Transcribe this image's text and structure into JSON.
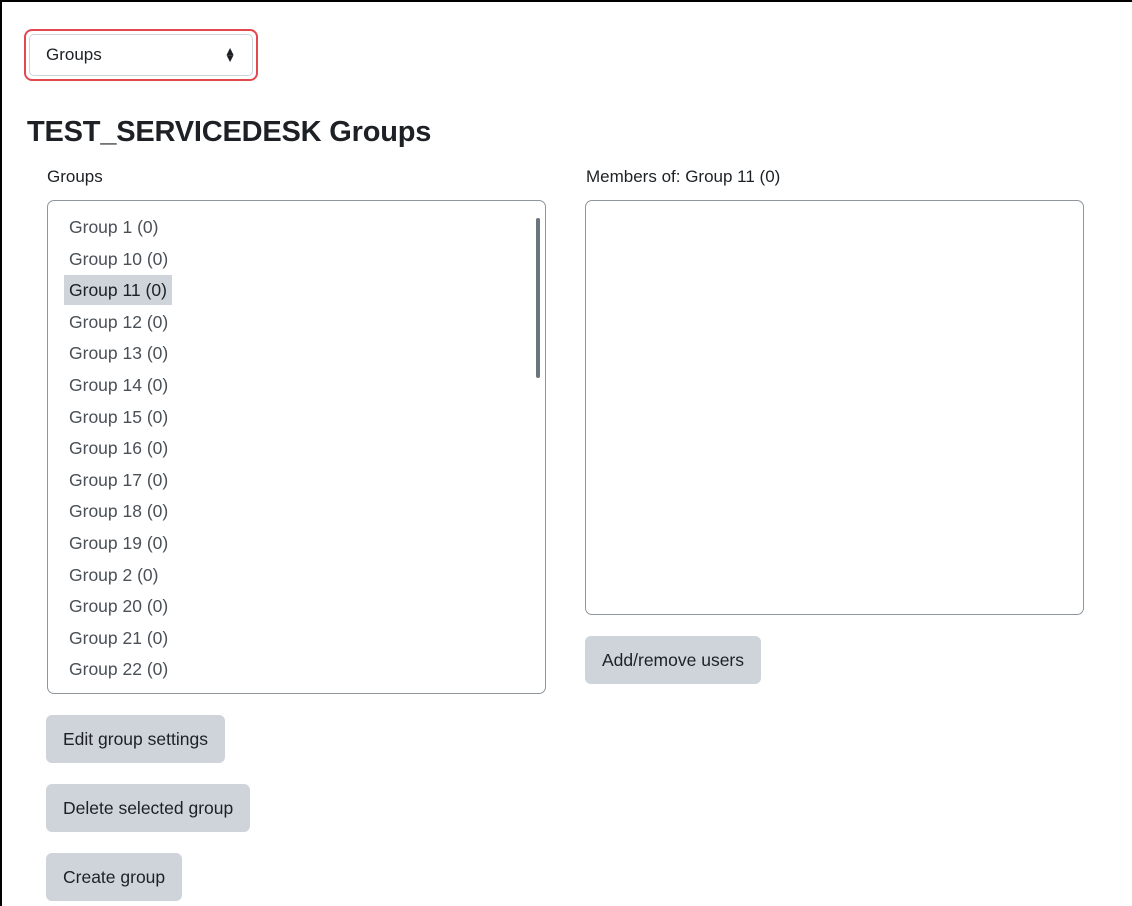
{
  "nav": {
    "selected": "Groups"
  },
  "page": {
    "title": "TEST_SERVICEDESK Groups"
  },
  "groups_panel": {
    "label": "Groups",
    "options": [
      "Group 1 (0)",
      "Group 10 (0)",
      "Group 11 (0)",
      "Group 12 (0)",
      "Group 13 (0)",
      "Group 14 (0)",
      "Group 15 (0)",
      "Group 16 (0)",
      "Group 17 (0)",
      "Group 18 (0)",
      "Group 19 (0)",
      "Group 2 (0)",
      "Group 20 (0)",
      "Group 21 (0)",
      "Group 22 (0)"
    ],
    "selected": "Group 11 (0)"
  },
  "members_panel": {
    "label": "Members of: Group 11 (0)",
    "members": []
  },
  "buttons": {
    "edit_group_settings": "Edit group settings",
    "delete_selected_group": "Delete selected group",
    "create_group": "Create group",
    "add_remove_users": "Add/remove users"
  },
  "colors": {
    "highlight_border": "#e4484f",
    "button_bg": "#ced4da",
    "selected_option_bg": "#ced4da"
  }
}
